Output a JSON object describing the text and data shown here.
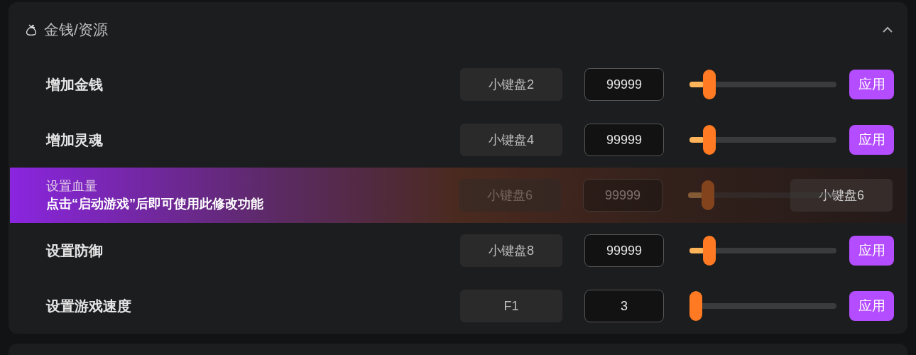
{
  "section": {
    "title": "金钱/资源",
    "expanded": true
  },
  "rows": [
    {
      "label": "增加金钱",
      "hotkey": "小键盘2",
      "value": "99999",
      "level": 0.1,
      "button": "应用",
      "disabled": false
    },
    {
      "label": "增加灵魂",
      "hotkey": "小键盘4",
      "value": "99999",
      "level": 0.1,
      "button": "应用",
      "disabled": false
    },
    {
      "label": "设置血量",
      "hotkey": "小键盘6",
      "value": "99999",
      "level": 0.1,
      "disabled": true,
      "notice": "点击“启动游戏”后即可使用此修改功能",
      "notice_hotkey": "小键盘6"
    },
    {
      "label": "设置防御",
      "hotkey": "小键盘8",
      "value": "99999",
      "level": 0.1,
      "button": "应用",
      "disabled": false
    },
    {
      "label": "设置游戏速度",
      "hotkey": "F1",
      "value": "3",
      "level": 0,
      "button": "应用",
      "disabled": false
    }
  ]
}
